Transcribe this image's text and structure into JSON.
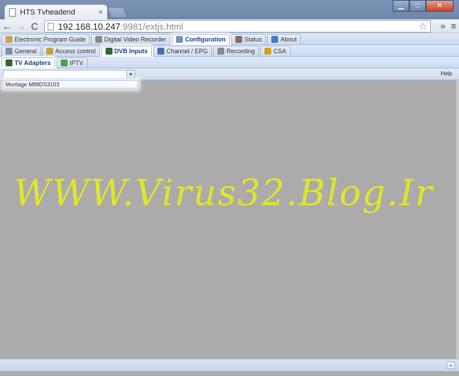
{
  "browser": {
    "tab_title": "HTS Tvheadend",
    "tab_close": "×",
    "url_host": "192.168.10.247",
    "url_rest": ":9981/extjs.html",
    "back": "←",
    "forward": "→",
    "reload": "C",
    "star": "☆",
    "more": "»",
    "menu": "≡",
    "minimize": "▁",
    "maximize": "□",
    "close": "✕"
  },
  "top_tabs": [
    {
      "label": "Electronic Program Guide",
      "icon_color": "#c9a35a"
    },
    {
      "label": "Digital Video Recorder",
      "icon_color": "#8a8a8a"
    },
    {
      "label": "Configuration",
      "icon_color": "#7b8fb0",
      "active": true
    },
    {
      "label": "Status",
      "icon_color": "#8a6b6b"
    },
    {
      "label": "About",
      "icon_color": "#4a78c4"
    }
  ],
  "config_tabs": [
    {
      "label": "General",
      "icon_color": "#7b8fb0"
    },
    {
      "label": "Access control",
      "icon_color": "#c8a040"
    },
    {
      "label": "DVB Inputs",
      "icon_color": "#2f6a2f",
      "active": true
    },
    {
      "label": "Channel / EPG",
      "icon_color": "#4a6fa8"
    },
    {
      "label": "Recording",
      "icon_color": "#8a8a8a"
    },
    {
      "label": "CSA",
      "icon_color": "#d4a020"
    }
  ],
  "dvb_tabs": [
    {
      "label": "TV Adapters",
      "icon_color": "#2f6a2f",
      "active": true
    },
    {
      "label": "IPTV",
      "icon_color": "#4aa04a"
    }
  ],
  "toolbar": {
    "help": "Help",
    "combo_arrow": "▾"
  },
  "dropdown_option": "Montage M88DS3103",
  "watermark": "WWW.Virus32.Blog.Ir",
  "statusbar": {
    "collapse": "»"
  }
}
